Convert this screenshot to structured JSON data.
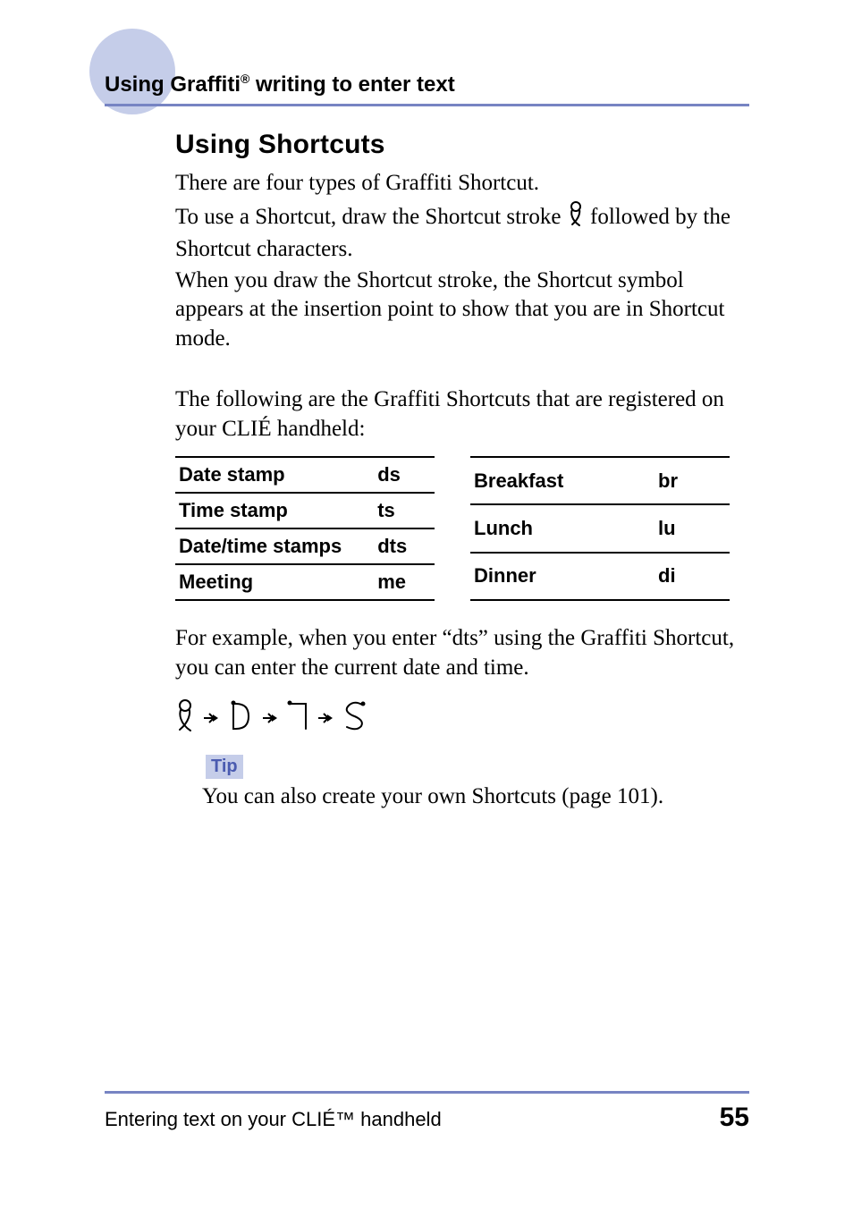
{
  "header": {
    "title_prefix": "Using Graffiti",
    "title_reg": "®",
    "title_suffix": " writing to enter text"
  },
  "section": {
    "heading": "Using Shortcuts",
    "p1": "There are four types of Graffiti Shortcut.",
    "p2a": "To use a Shortcut, draw the Shortcut stroke ",
    "p2b": " followed by the Shortcut characters.",
    "p3": "When you draw the Shortcut stroke, the Shortcut symbol appears at the insertion point to show that you are in Shortcut mode.",
    "p4": "The following are the Graffiti Shortcuts that are registered on your CLIÉ handheld:",
    "p5": "For example, when you enter “dts” using the Graffiti Shortcut, you can enter the current date and time."
  },
  "table_left": [
    {
      "name": "Date stamp",
      "code": "ds"
    },
    {
      "name": "Time stamp",
      "code": "ts"
    },
    {
      "name": "Date/time stamps",
      "code": "dts"
    },
    {
      "name": "Meeting",
      "code": "me"
    }
  ],
  "table_right": [
    {
      "name": "Breakfast",
      "code": "br"
    },
    {
      "name": "Lunch",
      "code": "lu"
    },
    {
      "name": "Dinner",
      "code": "di"
    }
  ],
  "tip": {
    "label": "Tip",
    "text": "You can also create your own Shortcuts (page 101)."
  },
  "footer": {
    "left": "Entering text on your CLIÉ™ handheld",
    "page": "55"
  }
}
